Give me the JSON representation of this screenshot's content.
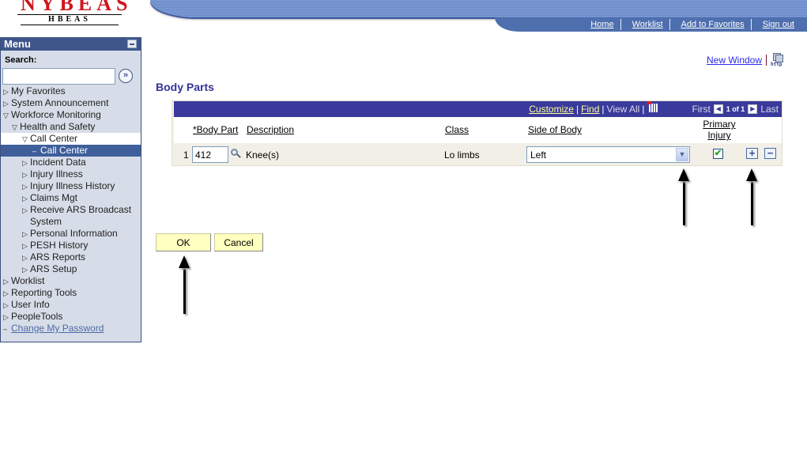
{
  "header": {
    "logo_main": "NYBEAS",
    "logo_sub": "HBEAS",
    "nav": [
      {
        "label": "Home"
      },
      {
        "label": "Worklist"
      },
      {
        "label": "Add to Favorites"
      },
      {
        "label": "Sign out"
      }
    ]
  },
  "sidebar": {
    "title": "Menu",
    "search_label": "Search:",
    "search_value": "",
    "search_go_icon": "double-chevron-right-icon",
    "items": [
      {
        "label": "My Favorites",
        "level": 0,
        "state": "collapsed"
      },
      {
        "label": "System Announcement",
        "level": 0,
        "state": "collapsed"
      },
      {
        "label": "Workforce Monitoring",
        "level": 0,
        "state": "expanded"
      },
      {
        "label": "Health and Safety",
        "level": 1,
        "state": "expanded"
      },
      {
        "label": "Call Center",
        "level": 2,
        "state": "expanded"
      },
      {
        "label": "Call Center",
        "level": 3,
        "state": "selected"
      },
      {
        "label": "Incident Data",
        "level": 2,
        "state": "collapsed"
      },
      {
        "label": "Injury Illness",
        "level": 2,
        "state": "collapsed"
      },
      {
        "label": "Injury Illness History",
        "level": 2,
        "state": "collapsed"
      },
      {
        "label": "Claims Mgt",
        "level": 2,
        "state": "collapsed"
      },
      {
        "label": "Receive ARS Broadcast System",
        "level": 2,
        "state": "collapsed"
      },
      {
        "label": "Personal Information",
        "level": 2,
        "state": "collapsed"
      },
      {
        "label": "PESH History",
        "level": 2,
        "state": "collapsed"
      },
      {
        "label": "ARS Reports",
        "level": 2,
        "state": "collapsed"
      },
      {
        "label": "ARS Setup",
        "level": 2,
        "state": "collapsed"
      },
      {
        "label": "Worklist",
        "level": 0,
        "state": "collapsed"
      },
      {
        "label": "Reporting Tools",
        "level": 0,
        "state": "collapsed"
      },
      {
        "label": "User Info",
        "level": 0,
        "state": "collapsed"
      },
      {
        "label": "PeopleTools",
        "level": 0,
        "state": "collapsed"
      },
      {
        "label": "Change My Password",
        "level": 0,
        "state": "link"
      }
    ]
  },
  "main": {
    "new_window_label": "New Window",
    "page_title": "Body Parts",
    "grid": {
      "toolbar": {
        "customize": "Customize",
        "find": "Find",
        "view_all": "View All",
        "sep": "|",
        "first": "First",
        "count": "1 of 1",
        "last": "Last"
      },
      "columns": {
        "body_part": "*Body Part",
        "description": "Description",
        "class": "Class",
        "side_of_body": "Side of Body",
        "primary_injury_line1": "Primary",
        "primary_injury_line2": "Injury"
      },
      "rows": [
        {
          "num": "1",
          "body_part": "412",
          "description": "Knee(s)",
          "class": "Lo limbs",
          "side_of_body": "Left",
          "primary_injury": true
        }
      ]
    },
    "buttons": {
      "ok": "OK",
      "cancel": "Cancel"
    }
  },
  "icons": {
    "check": "✔",
    "add": "+",
    "delete": "−",
    "dropdown": "▼",
    "prev": "◀",
    "next": "▶",
    "tri_collapsed": "▷",
    "tri_expanded": "▽",
    "leaf": "–",
    "go": "»",
    "http_label": "http"
  },
  "colors": {
    "banner": "#4e6fae",
    "menu_header": "#3f568b",
    "grid_bar": "#3a3a9c",
    "page_title": "#333399",
    "button_bg": "#ffffc0",
    "link_yellow": "#ffff99"
  }
}
